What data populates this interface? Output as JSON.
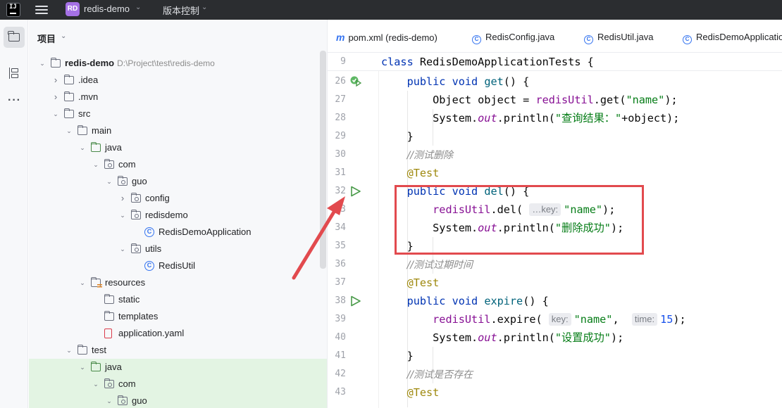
{
  "titlebar": {
    "logo": "IJ",
    "project_badge": "RD",
    "project_name": "redis-demo",
    "vcs_label": "版本控制"
  },
  "project_panel": {
    "header": "项目",
    "tree": [
      {
        "label": "redis-demo",
        "path": "D:\\Project\\test\\redis-demo",
        "depth": 0,
        "expanded": true,
        "type": "folder"
      },
      {
        "label": ".idea",
        "depth": 1,
        "expanded": false,
        "type": "folder"
      },
      {
        "label": ".mvn",
        "depth": 1,
        "expanded": false,
        "type": "folder"
      },
      {
        "label": "src",
        "depth": 1,
        "expanded": true,
        "type": "folder"
      },
      {
        "label": "main",
        "depth": 2,
        "expanded": true,
        "type": "folder"
      },
      {
        "label": "java",
        "depth": 3,
        "expanded": true,
        "type": "src-folder"
      },
      {
        "label": "com",
        "depth": 4,
        "expanded": true,
        "type": "package"
      },
      {
        "label": "guo",
        "depth": 5,
        "expanded": true,
        "type": "package"
      },
      {
        "label": "config",
        "depth": 6,
        "expanded": false,
        "type": "package"
      },
      {
        "label": "redisdemo",
        "depth": 6,
        "expanded": true,
        "type": "package"
      },
      {
        "label": "RedisDemoApplication",
        "depth": 7,
        "type": "class"
      },
      {
        "label": "utils",
        "depth": 6,
        "expanded": true,
        "type": "package"
      },
      {
        "label": "RedisUtil",
        "depth": 7,
        "type": "class"
      },
      {
        "label": "resources",
        "depth": 3,
        "expanded": true,
        "type": "resources"
      },
      {
        "label": "static",
        "depth": 4,
        "type": "folder"
      },
      {
        "label": "templates",
        "depth": 4,
        "type": "folder"
      },
      {
        "label": "application.yaml",
        "depth": 4,
        "type": "yaml"
      },
      {
        "label": "test",
        "depth": 2,
        "expanded": true,
        "type": "folder"
      },
      {
        "label": "java",
        "depth": 3,
        "expanded": true,
        "type": "src-folder",
        "highlighted": true
      },
      {
        "label": "com",
        "depth": 4,
        "expanded": true,
        "type": "package",
        "highlighted": true
      },
      {
        "label": "guo",
        "depth": 5,
        "expanded": true,
        "type": "package",
        "highlighted": true
      }
    ]
  },
  "editor": {
    "tabs": [
      {
        "label": "pom.xml (redis-demo)",
        "icon": "maven-icon"
      },
      {
        "label": "RedisConfig.java",
        "icon": "class-icon"
      },
      {
        "label": "RedisUtil.java",
        "icon": "class-icon"
      },
      {
        "label": "RedisDemoApplicatio",
        "icon": "class-icon"
      }
    ],
    "lines": [
      {
        "n": "9",
        "sticky": true,
        "run": false,
        "tokens": [
          [
            "kw",
            "class "
          ],
          [
            "",
            "RedisDemoApplicationTests {"
          ]
        ]
      },
      {
        "n": "26",
        "run": true,
        "run_style": "passed",
        "tokens": [
          [
            "",
            "    "
          ],
          [
            "kw",
            "public void "
          ],
          [
            "fn",
            "get"
          ],
          [
            "",
            "() {"
          ]
        ]
      },
      {
        "n": "27",
        "tokens": [
          [
            "",
            "        Object object = "
          ],
          [
            "fld",
            "redisUtil"
          ],
          [
            "",
            ".get("
          ],
          [
            "str",
            "\"name\""
          ],
          [
            "",
            ");"
          ]
        ]
      },
      {
        "n": "28",
        "tokens": [
          [
            "",
            "        System."
          ],
          [
            "it",
            "out"
          ],
          [
            "",
            ".println("
          ],
          [
            "str",
            "\"查询结果：\""
          ],
          [
            "",
            "+object);"
          ]
        ]
      },
      {
        "n": "29",
        "tokens": [
          [
            "",
            "    }"
          ]
        ]
      },
      {
        "n": "30",
        "tokens": [
          [
            "",
            "    "
          ],
          [
            "cm",
            "//测试删除"
          ]
        ]
      },
      {
        "n": "31",
        "tokens": [
          [
            "",
            "    "
          ],
          [
            "ann",
            "@Test"
          ]
        ]
      },
      {
        "n": "32",
        "run": true,
        "run_style": "run",
        "tokens": [
          [
            "",
            "    "
          ],
          [
            "kw",
            "public void "
          ],
          [
            "fn",
            "del"
          ],
          [
            "",
            "() {"
          ]
        ]
      },
      {
        "n": "33",
        "tokens": [
          [
            "",
            "        "
          ],
          [
            "fld",
            "redisUtil"
          ],
          [
            "",
            ".del( "
          ],
          [
            "hint",
            "…key:"
          ],
          [
            "str",
            "\"name\""
          ],
          [
            "",
            ");"
          ]
        ]
      },
      {
        "n": "34",
        "tokens": [
          [
            "",
            "        System."
          ],
          [
            "it",
            "out"
          ],
          [
            "",
            ".println("
          ],
          [
            "str",
            "\"删除成功\""
          ],
          [
            "",
            ");"
          ]
        ]
      },
      {
        "n": "35",
        "tokens": [
          [
            "",
            "    }"
          ]
        ]
      },
      {
        "n": "36",
        "tokens": [
          [
            "",
            "    "
          ],
          [
            "cm",
            "//测试过期时间"
          ]
        ]
      },
      {
        "n": "37",
        "tokens": [
          [
            "",
            "    "
          ],
          [
            "ann",
            "@Test"
          ]
        ]
      },
      {
        "n": "38",
        "run": true,
        "run_style": "run",
        "tokens": [
          [
            "",
            "    "
          ],
          [
            "kw",
            "public void "
          ],
          [
            "fn",
            "expire"
          ],
          [
            "",
            "() {"
          ]
        ]
      },
      {
        "n": "39",
        "tokens": [
          [
            "",
            "        "
          ],
          [
            "fld",
            "redisUtil"
          ],
          [
            "",
            ".expire( "
          ],
          [
            "hint",
            "key:"
          ],
          [
            "str",
            "\"name\""
          ],
          [
            "",
            ",  "
          ],
          [
            "hint",
            "time:"
          ],
          [
            "num",
            "15"
          ],
          [
            "",
            ");"
          ]
        ]
      },
      {
        "n": "40",
        "tokens": [
          [
            "",
            "        System."
          ],
          [
            "it",
            "out"
          ],
          [
            "",
            ".println("
          ],
          [
            "str",
            "\"设置成功\""
          ],
          [
            "",
            ");"
          ]
        ]
      },
      {
        "n": "41",
        "tokens": [
          [
            "",
            "    }"
          ]
        ]
      },
      {
        "n": "42",
        "tokens": [
          [
            "",
            "    "
          ],
          [
            "cm",
            "//测试是否存在"
          ]
        ]
      },
      {
        "n": "43",
        "tokens": [
          [
            "",
            "    "
          ],
          [
            "ann",
            "@Test"
          ]
        ]
      }
    ]
  },
  "colors": {
    "highlight_box": "#e24a4e",
    "arrow": "#e24a4e",
    "tree_selection": "#e3f4e3",
    "run_icon": "#4a9b4a"
  }
}
